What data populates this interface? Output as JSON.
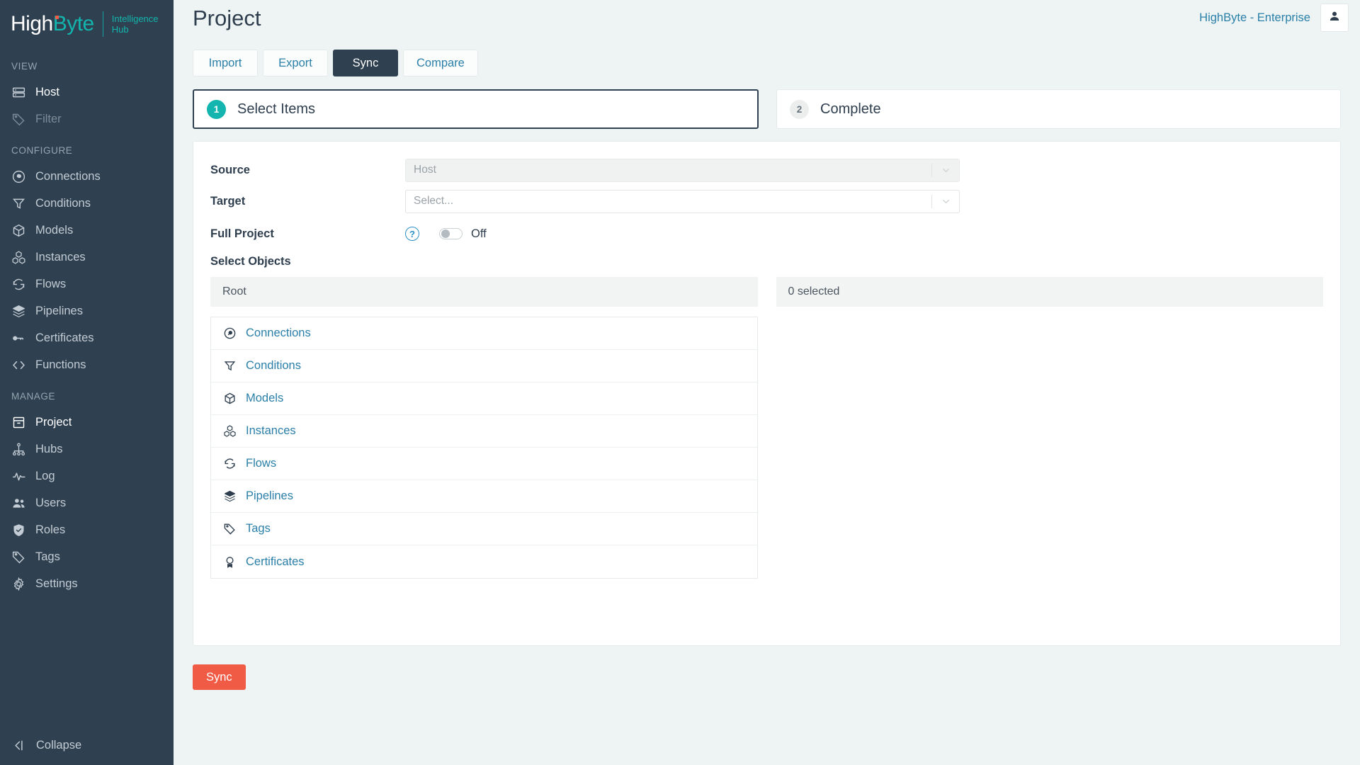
{
  "brand": {
    "name_first": "High",
    "name_second": "Byte",
    "tagline_line1": "Intelligence",
    "tagline_line2": "Hub",
    "accent_teal": "#12b5ad",
    "accent_orange": "#ef5b45",
    "sidebar_bg": "#2f4050"
  },
  "sidebar": {
    "sections": [
      {
        "label": "VIEW",
        "items": [
          {
            "label": "Host",
            "icon": "server-icon",
            "state": "active"
          },
          {
            "label": "Filter",
            "icon": "tag-icon",
            "state": "muted"
          }
        ]
      },
      {
        "label": "CONFIGURE",
        "items": [
          {
            "label": "Connections",
            "icon": "plug-circle-icon",
            "state": "normal"
          },
          {
            "label": "Conditions",
            "icon": "funnel-icon",
            "state": "normal"
          },
          {
            "label": "Models",
            "icon": "cube-icon",
            "state": "normal"
          },
          {
            "label": "Instances",
            "icon": "cubes-icon",
            "state": "normal"
          },
          {
            "label": "Flows",
            "icon": "refresh-icon",
            "state": "normal"
          },
          {
            "label": "Pipelines",
            "icon": "layers-icon",
            "state": "normal"
          },
          {
            "label": "Certificates",
            "icon": "key-icon",
            "state": "normal"
          },
          {
            "label": "Functions",
            "icon": "code-brackets-icon",
            "state": "normal"
          }
        ]
      },
      {
        "label": "MANAGE",
        "items": [
          {
            "label": "Project",
            "icon": "archive-box-icon",
            "state": "active"
          },
          {
            "label": "Hubs",
            "icon": "sitemap-icon",
            "state": "normal"
          },
          {
            "label": "Log",
            "icon": "pulse-icon",
            "state": "normal"
          },
          {
            "label": "Users",
            "icon": "users-icon",
            "state": "normal"
          },
          {
            "label": "Roles",
            "icon": "shield-check-icon",
            "state": "normal"
          },
          {
            "label": "Tags",
            "icon": "tag-icon",
            "state": "normal"
          },
          {
            "label": "Settings",
            "icon": "gear-icon",
            "state": "normal"
          }
        ]
      }
    ],
    "collapse_label": "Collapse"
  },
  "header": {
    "page_title": "Project",
    "org_name": "HighByte - Enterprise",
    "avatar_icon": "user-icon"
  },
  "tabs": [
    {
      "label": "Import",
      "active": false
    },
    {
      "label": "Export",
      "active": false
    },
    {
      "label": "Sync",
      "active": true
    },
    {
      "label": "Compare",
      "active": false
    }
  ],
  "steps": [
    {
      "number": "1",
      "label": "Select Items",
      "current": true
    },
    {
      "number": "2",
      "label": "Complete",
      "current": false
    }
  ],
  "form": {
    "source": {
      "label": "Source",
      "value": "Host",
      "disabled": true,
      "caret_icon": "chevron-down-icon"
    },
    "target": {
      "label": "Target",
      "placeholder": "Select...",
      "value": "Select...",
      "disabled": false,
      "caret_icon": "chevron-down-icon"
    },
    "full_project": {
      "label": "Full Project",
      "help_icon": "question-mark-icon",
      "help_glyph": "?",
      "toggle_state": "Off",
      "toggle_on": false
    },
    "select_objects_label": "Select Objects"
  },
  "dual_list": {
    "left_header": "Root",
    "right_header": "0 selected",
    "items": [
      {
        "label": "Connections",
        "icon": "plug-circle-icon"
      },
      {
        "label": "Conditions",
        "icon": "funnel-icon"
      },
      {
        "label": "Models",
        "icon": "cube-icon"
      },
      {
        "label": "Instances",
        "icon": "cubes-icon"
      },
      {
        "label": "Flows",
        "icon": "refresh-icon"
      },
      {
        "label": "Pipelines",
        "icon": "layers-icon"
      },
      {
        "label": "Tags",
        "icon": "tag-icon"
      },
      {
        "label": "Certificates",
        "icon": "certificate-seal-icon"
      }
    ],
    "selected_items": []
  },
  "actions": {
    "sync_label": "Sync",
    "sync_color": "#ef5b45"
  }
}
